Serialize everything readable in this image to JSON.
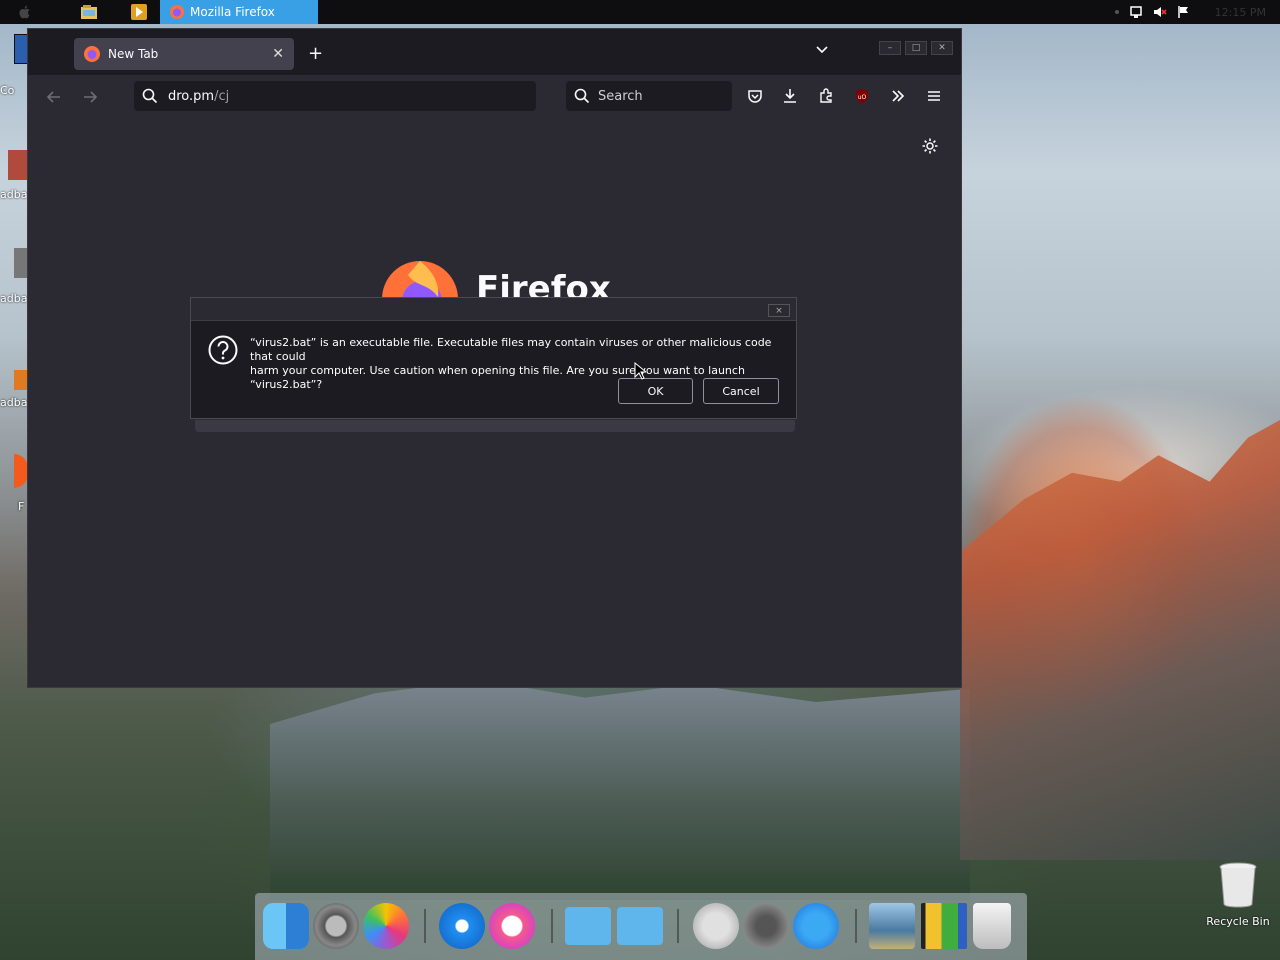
{
  "taskbar": {
    "task_label": "Mozilla Firefox",
    "clock": "12:15 PM"
  },
  "desktop": {
    "labels": [
      "Co",
      "adba",
      "adba",
      "adba",
      "F"
    ],
    "recycle_bin": "Recycle Bin"
  },
  "browser": {
    "tab_title": "New Tab",
    "url_host": "dro.pm",
    "url_path": "/cj",
    "search_placeholder": "Search",
    "brand_word": "Firefox"
  },
  "dialog": {
    "message_line1": "“virus2.bat” is an executable file. Executable files may contain viruses or other malicious code that could",
    "message_line2": "harm your computer. Use caution when opening this file. Are you sure you want to launch “virus2.bat”?",
    "ok_label": "OK",
    "cancel_label": "Cancel",
    "close_glyph": "×"
  },
  "dock": {
    "items": [
      "finder-icon",
      "system-preferences-icon",
      "photos-icon",
      "safari-icon",
      "itunes-icon",
      "folder-icon",
      "applications-folder-icon",
      "shutdown-icon",
      "launchpad-icon",
      "app-store-icon",
      "preview-icon",
      "photo-booth-icon",
      "trash-icon"
    ]
  },
  "colors": {
    "taskbar_active": "#3aa0e6",
    "window_bg": "#1c1b22",
    "toolbar_bg": "#2b2a33"
  }
}
